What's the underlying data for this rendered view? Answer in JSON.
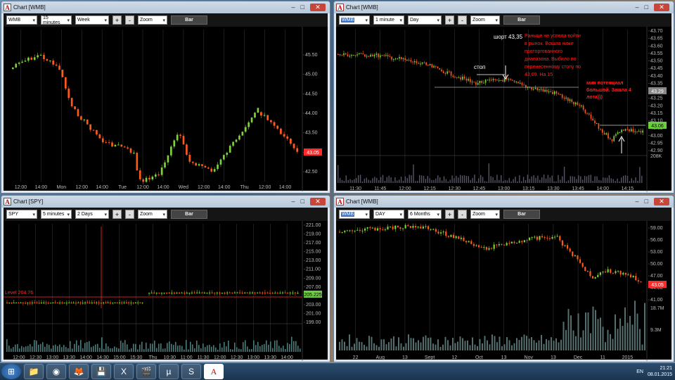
{
  "colors": {
    "up": "#7fd23a",
    "down": "#ff5a1a",
    "grid": "#3a3a3a",
    "text": "#bbbbbb",
    "marker_red": "#ff2a2a",
    "marker_green": "#6bd13a",
    "annotation": "#ff2020"
  },
  "windows": [
    {
      "title": "Chart [WMB]",
      "symbol": "WMB",
      "interval": "15 minutes",
      "range": "Week",
      "zoom": "Zoom",
      "bar_label": "Bar",
      "y_ticks": [
        "45.50",
        "45.00",
        "44.50",
        "44.00",
        "43.50",
        "43.00",
        "42.50"
      ],
      "current_price": "43.05",
      "x_ticks": [
        "12:00",
        "14:00",
        "Mon",
        "12:00",
        "14:00",
        "Tue",
        "12:00",
        "14:00",
        "Wed",
        "12:00",
        "14:00",
        "Thu",
        "12:00",
        "14:00"
      ]
    },
    {
      "title": "Chart [WMB]",
      "symbol": "WMB",
      "interval": "1 minute",
      "range": "Day",
      "zoom": "Zoom",
      "bar_label": "Bar",
      "y_ticks": [
        "43.70",
        "43.65",
        "43.60",
        "43.55",
        "43.50",
        "43.45",
        "43.40",
        "43.35",
        "43.30",
        "43.25",
        "43.20",
        "43.15",
        "43.10",
        "43.05",
        "43.00",
        "42.95",
        "42.90",
        "208K"
      ],
      "current_price": "43.06",
      "marker_price": "43.29",
      "x_ticks": [
        "11:30",
        "11:45",
        "12:00",
        "12:15",
        "12:30",
        "12:45",
        "13:00",
        "13:15",
        "13:30",
        "13:45",
        "14:00",
        "14:15"
      ],
      "annotations": {
        "short": "шорт 43,35",
        "stop": "стоп",
        "note1": "Раньше не успела войти в рынок. Вошла ниже проторгованного диапазона. Выбило по перенесенному стопу по 43,09. На 15",
        "note2": "мин потенциал большой. Зашла 4 лота)))"
      }
    },
    {
      "title": "Chart [SPY]",
      "symbol": "SPY",
      "interval": "5 minutes",
      "range": "2 Days",
      "zoom": "Zoom",
      "bar_label": "Bar",
      "y_ticks": [
        "221.00",
        "219.00",
        "217.00",
        "215.00",
        "213.00",
        "211.00",
        "209.00",
        "207.00",
        "205.00",
        "203.00",
        "201.00",
        "199.00"
      ],
      "level_label": "Level 204.76",
      "current_price": "205.225",
      "x_ticks": [
        "12:00",
        "12:30",
        "13:00",
        "13:30",
        "14:00",
        "14:30",
        "15:00",
        "15:30",
        "Thu",
        "10:30",
        "11:00",
        "11:30",
        "12:00",
        "12:30",
        "13:00",
        "13:30",
        "14:00"
      ]
    },
    {
      "title": "Chart [WMB]",
      "symbol": "WMB",
      "interval": "DAY",
      "range": "6 Months",
      "zoom": "Zoom",
      "bar_label": "Bar",
      "y_ticks": [
        "59.00",
        "56.00",
        "53.00",
        "50.00",
        "47.00",
        "44.00",
        "41.00",
        "18.7M",
        "9.3M"
      ],
      "current_price": "43.05",
      "x_ticks": [
        "22",
        "Aug",
        "13",
        "Sept",
        "12",
        "Oct",
        "13",
        "Nov",
        "13",
        "Dec",
        "11",
        "2015"
      ]
    }
  ],
  "taskbar": {
    "start_icon": "windows-orb",
    "apps": [
      "explorer",
      "chrome",
      "firefox",
      "save",
      "excel",
      "video",
      "utorrent",
      "skype",
      "acrobat"
    ],
    "lang": "EN",
    "time": "21:21",
    "date": "08.01.2015"
  }
}
